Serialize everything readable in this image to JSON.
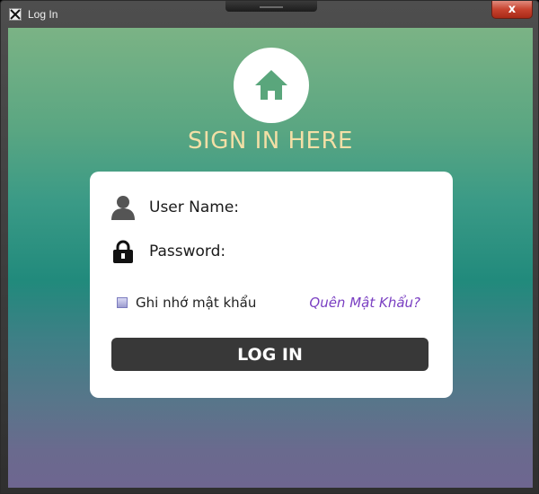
{
  "window": {
    "title": "Log In",
    "close_label": "x",
    "icons": {
      "app": "app-icon",
      "close": "close-icon"
    }
  },
  "header": {
    "icon": "home-icon",
    "title": "SIGN IN HERE"
  },
  "form": {
    "username_label": "User Name:",
    "username_icon": "user-icon",
    "password_label": "Password:",
    "password_icon": "lock-icon",
    "remember_label": "Ghi nhớ mật khẩu",
    "remember_checked": false,
    "forgot_label": "Quên Mật Khẩu?",
    "login_label": "LOG IN"
  },
  "colors": {
    "heading": "#f3dfa6",
    "forgot_link": "#7a3fc2",
    "login_button": "#383838"
  }
}
